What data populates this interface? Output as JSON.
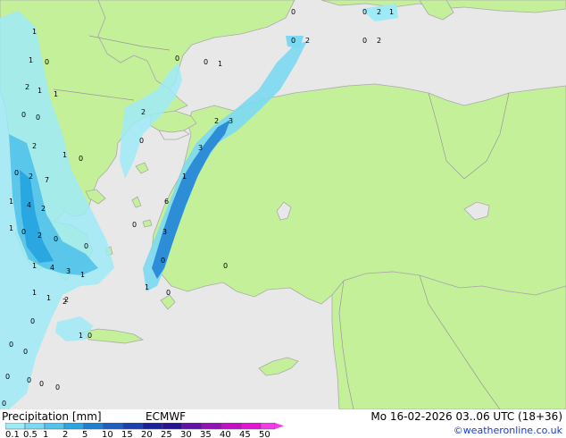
{
  "map": {
    "sea_color": "#e8e8e8",
    "land_color": "#c4f099",
    "border_color": "#aaaaaa",
    "precip_labels": [
      "1",
      "0",
      "1",
      "0",
      "2",
      "1",
      "1",
      "0",
      "0",
      "0",
      "2",
      "1",
      "0",
      "2",
      "0",
      "2",
      "7",
      "1",
      "0",
      "4",
      "2",
      "0",
      "1",
      "2",
      "2",
      "0",
      "0",
      "1",
      "4",
      "3",
      "1",
      "0",
      "1",
      "1",
      "2",
      "0",
      "1",
      "1",
      "0",
      "0",
      "0",
      "0",
      "0",
      "2",
      "0",
      "2",
      "0",
      "0",
      "2",
      "1",
      "0",
      "0",
      "0",
      "0",
      "2",
      "3",
      "3",
      "1",
      "6",
      "3",
      "0",
      "1",
      "0",
      "0"
    ]
  },
  "footer": {
    "title": "Precipitation [mm]",
    "model": "ECMWF",
    "valid": "Mo 16-02-2026 03..06 UTC (18+36)",
    "credit": "©weatheronline.co.uk",
    "scale_colors": [
      "#9feaf7",
      "#7cd9f2",
      "#52c3ea",
      "#2aa6e0",
      "#1f7fd3",
      "#1f5fc4",
      "#1c3fb3",
      "#17219d",
      "#271292",
      "#6012a8",
      "#9410b8",
      "#c10fc7",
      "#e214d4",
      "#f23de6"
    ],
    "scale_labels": [
      "0.1",
      "0.5",
      "1",
      "2",
      "5",
      "10",
      "15",
      "20",
      "25",
      "30",
      "35",
      "40",
      "45",
      "50"
    ]
  }
}
